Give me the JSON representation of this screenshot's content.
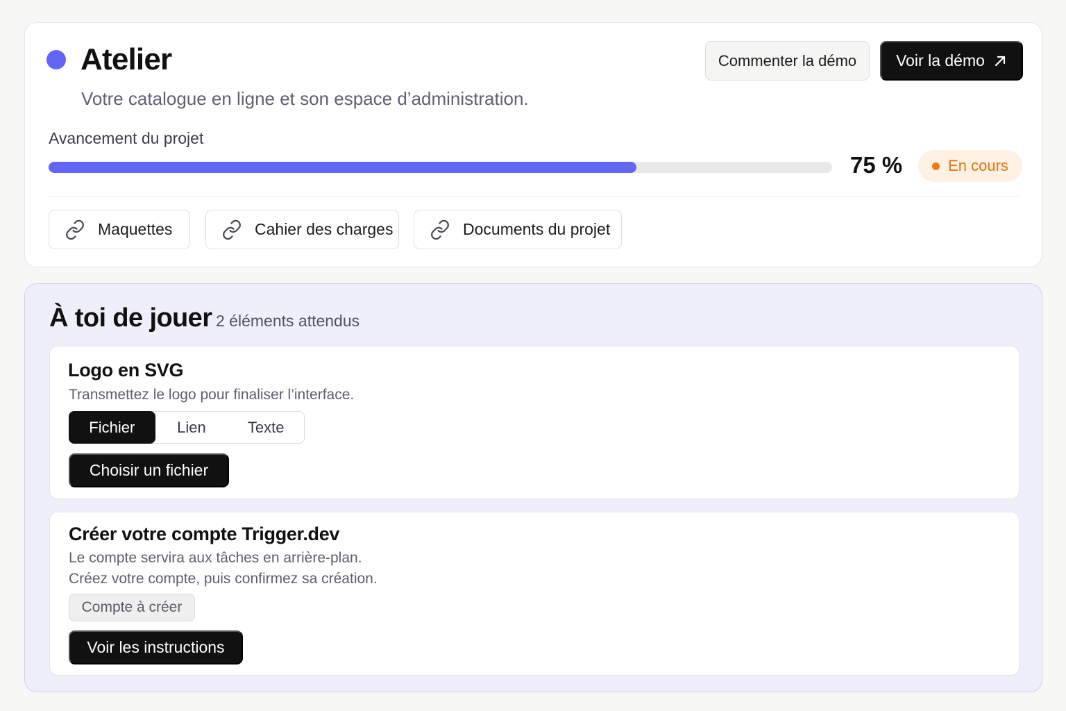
{
  "project": {
    "title": "Atelier",
    "subtitle": "Votre catalogue en ligne et son espace d’administration.",
    "comment_button": "Commenter la démo",
    "view_button": "Voir la démo",
    "progress_label": "Avancement du projet",
    "progress_percent": 75,
    "progress_text": "75 %",
    "status": "En cours",
    "links": [
      {
        "label": "Maquettes"
      },
      {
        "label": "Cahier des charges"
      },
      {
        "label": "Documents du projet"
      }
    ]
  },
  "tasks": {
    "title": "À toi de jouer",
    "count": "2 éléments attendus",
    "logo": {
      "title": "Logo en SVG",
      "description": "Transmettez le logo pour finaliser l’interface.",
      "tabs": [
        "Fichier",
        "Lien",
        "Texte"
      ],
      "selected_tab": "Fichier",
      "action": "Choisir un fichier"
    },
    "trigger": {
      "title": "Créer votre compte Trigger.dev",
      "description_1": "Le compte servira aux tâches en arrière-plan.",
      "description_2": "Créez votre compte, puis confirmez sa création.",
      "status": "Compte à créer",
      "action": "Voir les instructions"
    }
  },
  "colors": {
    "accent": "#6166f5",
    "status_orange": "#e4730c",
    "panel_bg": "#efeffc"
  },
  "icons": {
    "status": "dot-icon",
    "external": "arrow-up-right-icon",
    "link": "link-icon"
  }
}
